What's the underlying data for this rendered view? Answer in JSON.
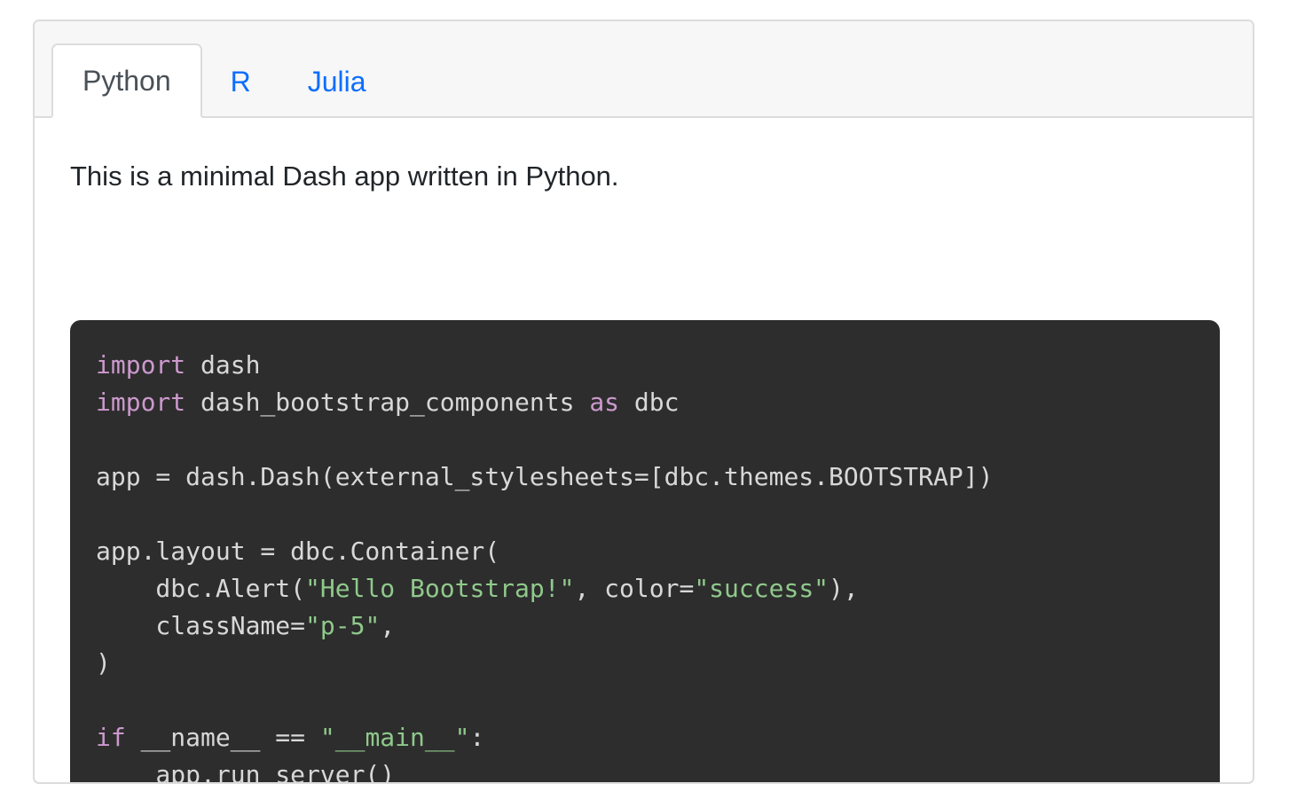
{
  "tabs": [
    {
      "label": "Python",
      "active": true
    },
    {
      "label": "R",
      "active": false
    },
    {
      "label": "Julia",
      "active": false
    }
  ],
  "description": "This is a minimal Dash app written in Python.",
  "colors": {
    "tab_link": "#0d6efd",
    "tab_active_text": "#495057",
    "code_background": "#2d2d2d",
    "code_text": "#d8d8d8",
    "code_keyword": "#cc99cd",
    "code_string": "#8fc98b"
  },
  "code": {
    "language": "python",
    "lines": [
      [
        {
          "t": "import",
          "c": "kw"
        },
        {
          "t": " dash",
          "c": ""
        }
      ],
      [
        {
          "t": "import",
          "c": "kw"
        },
        {
          "t": " dash_bootstrap_components ",
          "c": ""
        },
        {
          "t": "as",
          "c": "kw"
        },
        {
          "t": " dbc",
          "c": ""
        }
      ],
      [],
      [
        {
          "t": "app = dash.Dash(external_stylesheets=[dbc.themes.BOOTSTRAP])",
          "c": ""
        }
      ],
      [],
      [
        {
          "t": "app.layout = dbc.Container(",
          "c": ""
        }
      ],
      [
        {
          "t": "    dbc.Alert(",
          "c": ""
        },
        {
          "t": "\"Hello Bootstrap!\"",
          "c": "str"
        },
        {
          "t": ", color=",
          "c": ""
        },
        {
          "t": "\"success\"",
          "c": "str"
        },
        {
          "t": "),",
          "c": ""
        }
      ],
      [
        {
          "t": "    className=",
          "c": ""
        },
        {
          "t": "\"p-5\"",
          "c": "str"
        },
        {
          "t": ",",
          "c": ""
        }
      ],
      [
        {
          "t": ")",
          "c": ""
        }
      ],
      [],
      [
        {
          "t": "if",
          "c": "kw"
        },
        {
          "t": " __name__ == ",
          "c": ""
        },
        {
          "t": "\"__main__\"",
          "c": "str"
        },
        {
          "t": ":",
          "c": ""
        }
      ],
      [
        {
          "t": "    app.run_server()",
          "c": ""
        }
      ]
    ]
  }
}
